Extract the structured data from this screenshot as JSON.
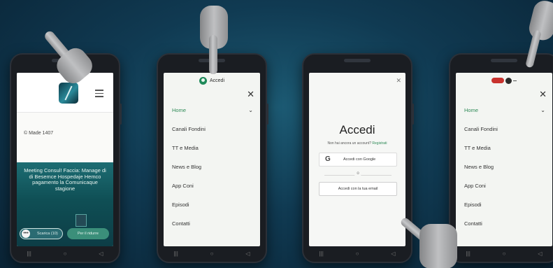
{
  "phone1": {
    "made_with": "© Made 1407",
    "hero_title": "Meeting Consul! Faccia: Manage di di Besemce Hospedaje Hemco pagamento la Comunicaque stagione",
    "btn_left": "Scarica (10)",
    "btn_right": "Per il ridurre",
    "dot_icon": "•••"
  },
  "phone2": {
    "header_label": "Accedi",
    "close": "✕",
    "menu": [
      {
        "label": "Home",
        "active": true
      },
      {
        "label": "Canali Fondini",
        "active": false
      },
      {
        "label": "TT e Media",
        "active": false
      },
      {
        "label": "News e Blog",
        "active": false
      },
      {
        "label": "App Coni",
        "active": false
      },
      {
        "label": "Episodi",
        "active": false
      },
      {
        "label": "Contatti",
        "active": false
      }
    ]
  },
  "phone3": {
    "close": "✕",
    "title": "Accedi",
    "subtitle": "Non hai ancora un account?",
    "register": "Registrati",
    "google_label": "Accedi con Google",
    "google_icon": "G",
    "divider": "o",
    "email_label": "Accedi con la tua email"
  },
  "phone4": {
    "close": "✕",
    "menu": [
      {
        "label": "Home",
        "active": true
      },
      {
        "label": "Canali Fondini",
        "active": false
      },
      {
        "label": "TT e Media",
        "active": false
      },
      {
        "label": "News e Blog",
        "active": false
      },
      {
        "label": "App Coni",
        "active": false
      },
      {
        "label": "Episodi",
        "active": false
      },
      {
        "label": "Contatti",
        "active": false
      }
    ]
  },
  "navbar": {
    "back": "◁",
    "home": "○",
    "recents": "|||"
  },
  "colors": {
    "accent": "#2e8a57",
    "background": "#103a52"
  }
}
